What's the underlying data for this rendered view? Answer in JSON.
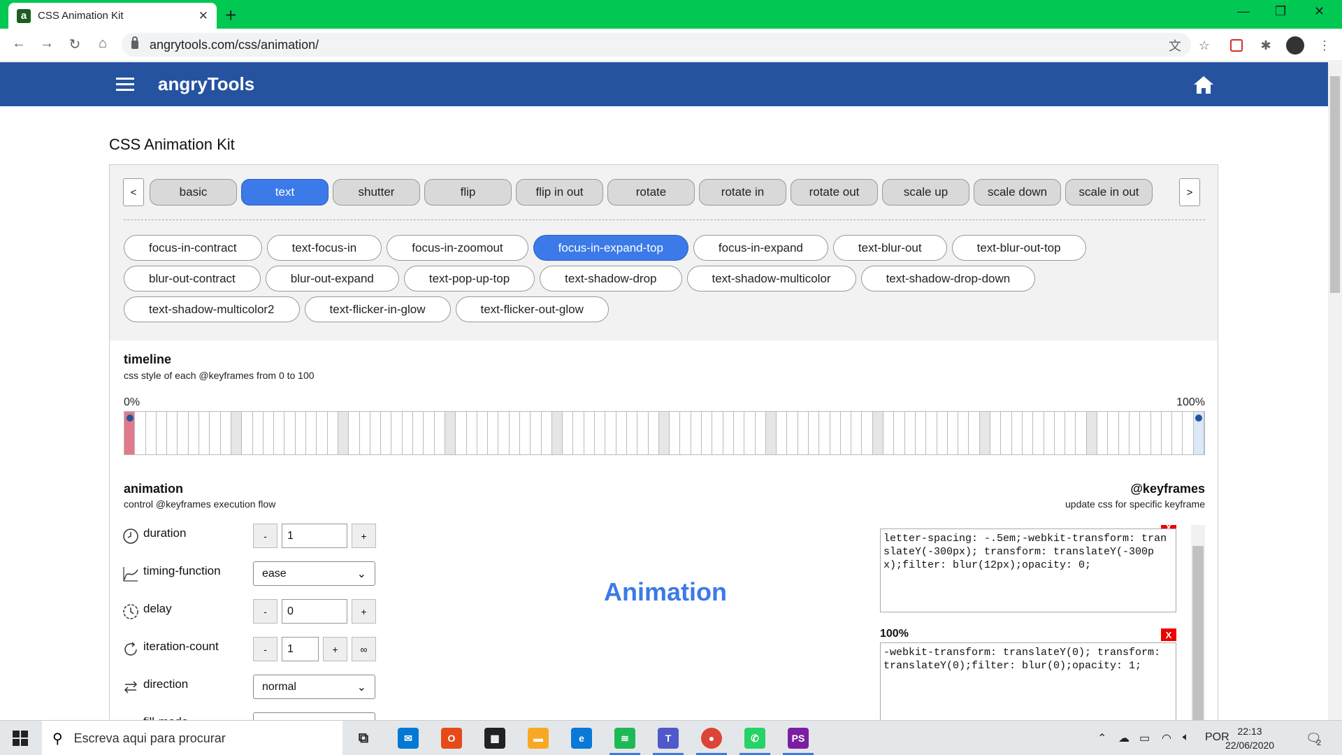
{
  "browser": {
    "tab_title": "CSS Animation Kit",
    "favicon_letter": "a",
    "tab_close": "✕",
    "new_tab": "+",
    "url": "angrytools.com/css/animation/",
    "minimize": "—",
    "restore": "❐",
    "close": "✕"
  },
  "site": {
    "logo": "angryTools"
  },
  "page": {
    "title": "CSS Animation Kit"
  },
  "categories": {
    "prev": "<",
    "next": ">",
    "items": [
      "basic",
      "text",
      "shutter",
      "flip",
      "flip in out",
      "rotate",
      "rotate in",
      "rotate out",
      "scale up",
      "scale down",
      "scale in out"
    ],
    "active": "text"
  },
  "animations": {
    "row1": [
      "focus-in-contract",
      "text-focus-in",
      "focus-in-zoomout",
      "focus-in-expand-top",
      "focus-in-expand",
      "text-blur-out",
      "text-blur-out-top"
    ],
    "row2": [
      "blur-out-contract",
      "blur-out-expand",
      "text-pop-up-top",
      "text-shadow-drop",
      "text-shadow-multicolor",
      "text-shadow-drop-down"
    ],
    "row3": [
      "text-shadow-multicolor2",
      "text-flicker-in-glow",
      "text-flicker-out-glow"
    ],
    "active": "focus-in-expand-top"
  },
  "timeline": {
    "title": "timeline",
    "subtitle": "css style of each @keyframes from 0 to 100",
    "start_label": "0%",
    "end_label": "100%"
  },
  "animation": {
    "title": "animation",
    "subtitle": "control @keyframes execution flow",
    "duration_label": "duration",
    "duration_value": "1",
    "timing_label": "timing-function",
    "timing_value": "ease",
    "delay_label": "delay",
    "delay_value": "0",
    "iteration_label": "iteration-count",
    "iteration_value": "1",
    "direction_label": "direction",
    "direction_value": "normal",
    "fill_label": "fill-mode",
    "minus": "-",
    "plus": "+",
    "infinite": "∞",
    "preview_text": "Animation"
  },
  "keyframes": {
    "title": "@keyframes",
    "subtitle": "update css for specific keyframe",
    "kf0_css": "letter-spacing: -.5em;-webkit-transform: translateY(-300px); transform: translateY(-300px);filter: blur(12px);opacity: 0;",
    "kf100_label": "100%",
    "kf100_css": "-webkit-transform: translateY(0); transform: translateY(0);filter: blur(0);opacity: 1;",
    "delete": "X"
  },
  "taskbar": {
    "search_placeholder": "Escreva aqui para procurar",
    "language": "POR",
    "time": "22:13",
    "date": "22/06/2020",
    "notifications": "2"
  }
}
